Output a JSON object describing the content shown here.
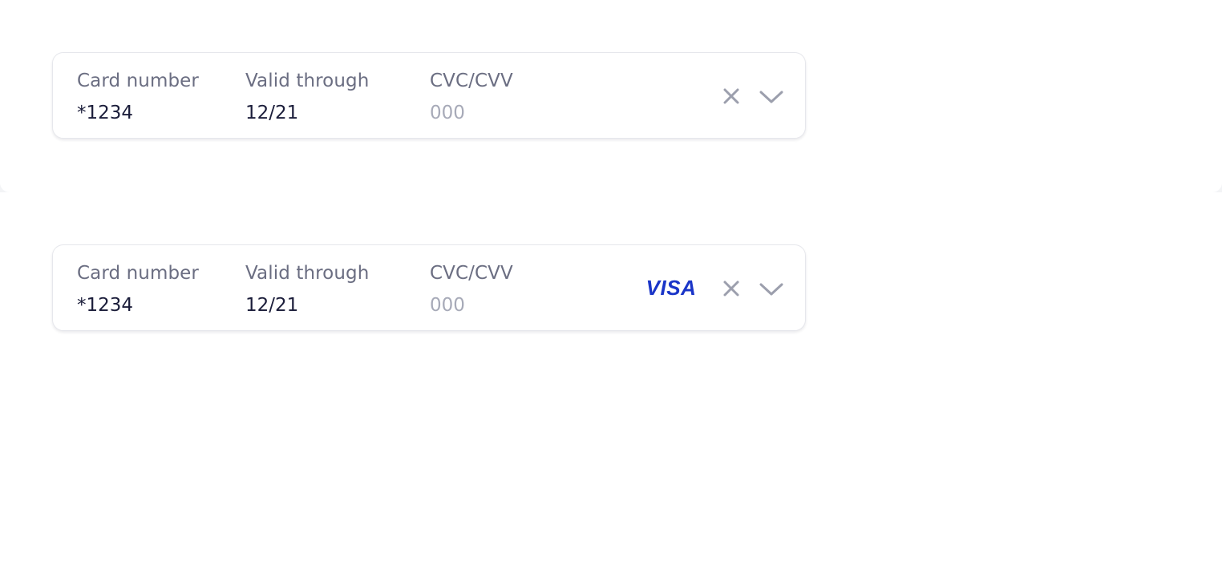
{
  "card_fields": [
    {
      "number_label": "Card number",
      "number_value": "*1234",
      "valid_label": "Valid through",
      "valid_value": "12/21",
      "cvc_label": "CVC/CVV",
      "cvc_placeholder": "000",
      "show_brand": false
    },
    {
      "number_label": "Card number",
      "number_value": "*1234",
      "valid_label": "Valid through",
      "valid_value": "12/21",
      "cvc_label": "CVC/CVV",
      "cvc_placeholder": "000",
      "show_brand": true,
      "brand_text": "VISA",
      "brand_color": "#1a35c8"
    }
  ],
  "annotation": {
    "text": "VISA",
    "color": "#ff0000"
  },
  "icons": {
    "clear": "close-icon",
    "expand": "chevron-down-icon"
  },
  "colors": {
    "label": "#6b6e82",
    "value": "#1b1d3a",
    "placeholder": "#a7aab8",
    "icon": "#9c9fad",
    "border": "#e6e7ec"
  }
}
